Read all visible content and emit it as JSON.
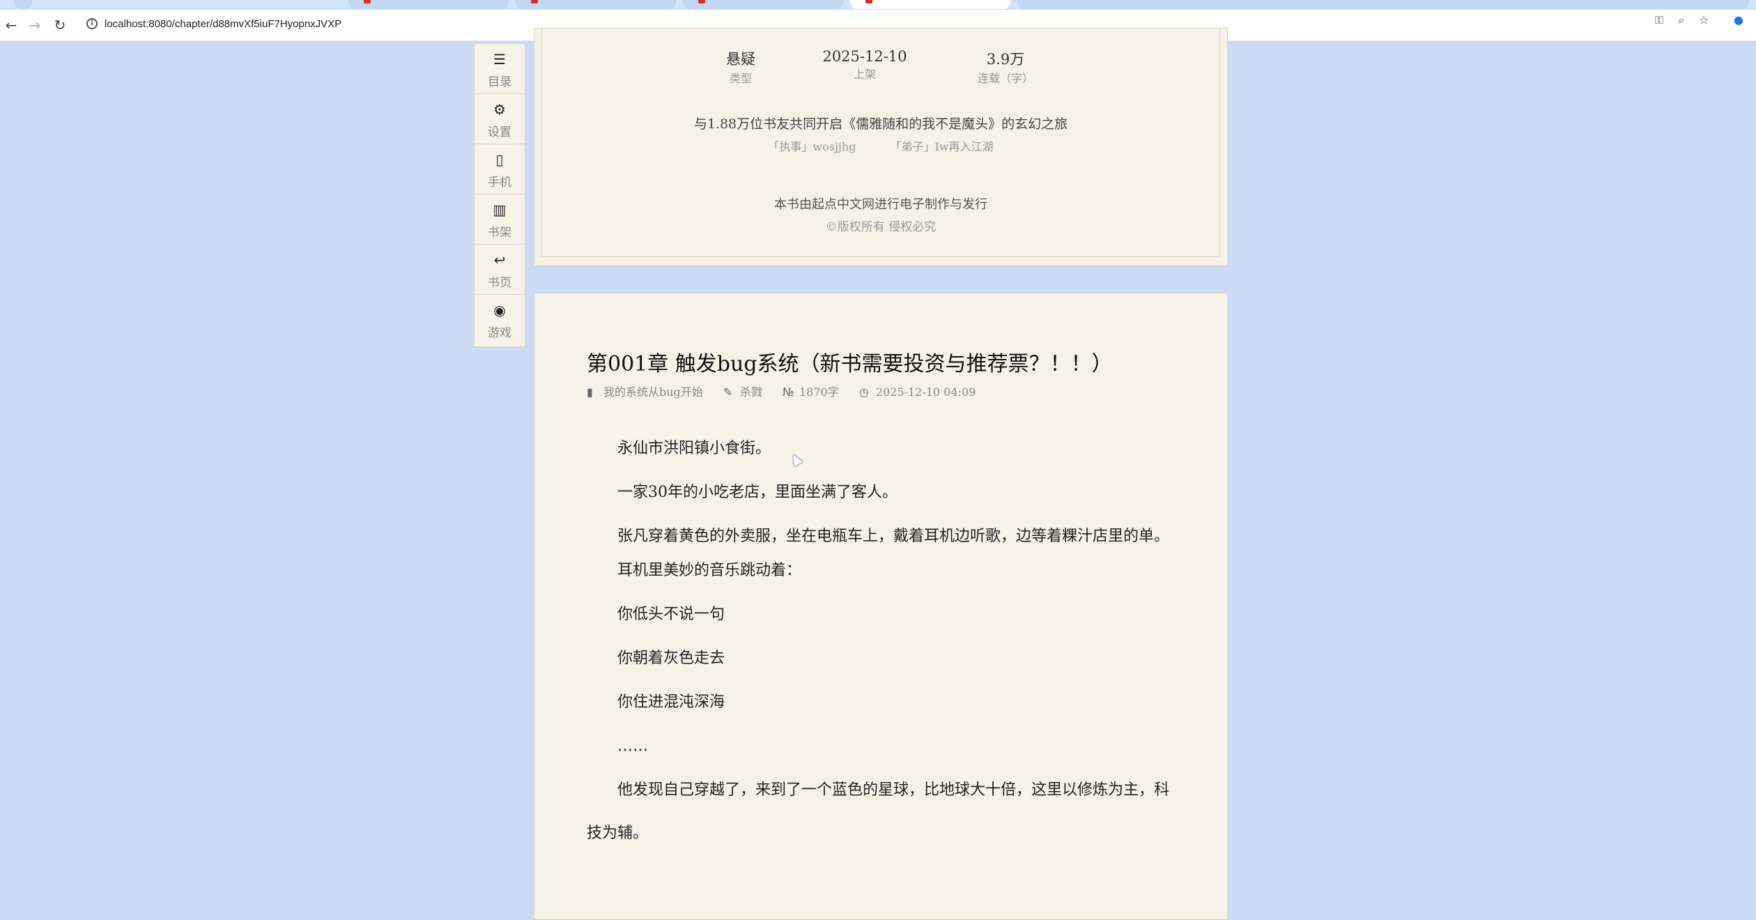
{
  "browser": {
    "url": "localhost:8080/chapter/d88mvXf5iuF7HyopnxJVXP",
    "back_icon": "←",
    "forward_icon": "→",
    "reload_icon": "↻",
    "info_icon": "i",
    "right_icons": {
      "key": "⚿",
      "zoom": "⌕",
      "star": "☆",
      "profile": "●"
    }
  },
  "sidemenu": {
    "items": [
      {
        "icon": "☰",
        "label": "目录"
      },
      {
        "icon": "⚙",
        "label": "设置"
      },
      {
        "icon": "▯",
        "label": "手机"
      },
      {
        "icon": "▥",
        "label": "书架"
      },
      {
        "icon": "↩",
        "label": "书页"
      },
      {
        "icon": "◉",
        "label": "游戏"
      }
    ]
  },
  "info": {
    "stats": [
      {
        "value": "悬疑",
        "label": "类型"
      },
      {
        "value": "2025-12-10",
        "label": "上架"
      },
      {
        "value": "3.9万",
        "label": "连载（字）"
      }
    ],
    "readers_line": "与1.88万位书友共同开启《儒雅随和的我不是魔头》的玄幻之旅",
    "fans": [
      "「执事」wosjjhg",
      "「弟子」Iw再入江湖"
    ],
    "publisher": "本书由起点中文网进行电子制作与发行",
    "copyright": "©版权所有 侵权必究"
  },
  "chapter": {
    "title": "第001章 触发bug系统（新书需要投资与推荐票？！！）",
    "meta": {
      "book": "我的系统从bug开始",
      "author": "杀戮",
      "words": "1870字",
      "time": "2025-12-10 04:09"
    },
    "paragraphs": [
      "永仙市洪阳镇小食街。",
      "一家30年的小吃老店，里面坐满了客人。",
      "张凡穿着黄色的外卖服，坐在电瓶车上，戴着耳机边听歌，边等着粿汁店里的单。",
      "耳机里美妙的音乐跳动着：",
      "你低头不说一句",
      "你朝着灰色走去",
      "你住进混沌深海",
      "……",
      "他发现自己穿越了，来到了一个蓝色的星球，比地球大十倍，这里以修炼为主，科技为辅。"
    ]
  }
}
